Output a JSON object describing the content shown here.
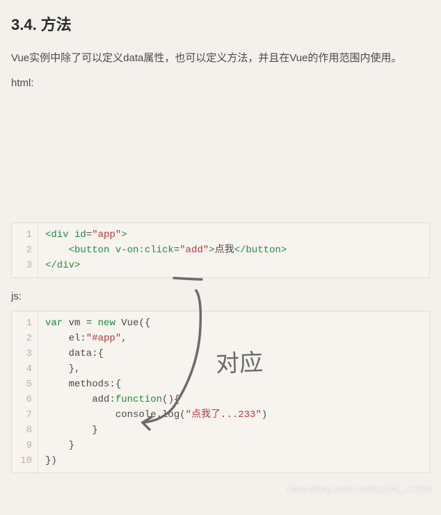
{
  "heading": "3.4. 方法",
  "paragraph": "Vue实例中除了可以定义data属性，也可以定义方法，并且在Vue的作用范围内使用。",
  "label_html": "html:",
  "label_js": "js:",
  "code_html": {
    "line_numbers": [
      "1",
      "2",
      "3"
    ],
    "l1_open": "<div",
    "l1_attr": " id",
    "l1_eq": "=",
    "l1_val": "\"app\"",
    "l1_close": ">",
    "l2_indent": "    ",
    "l2_open": "<button",
    "l2_attr": " v-on:click",
    "l2_eq": "=",
    "l2_val": "\"add\"",
    "l2_close": ">",
    "l2_text": "点我",
    "l2_end": "</button>",
    "l3": "</div>"
  },
  "code_js": {
    "line_numbers": [
      "1",
      "2",
      "3",
      "4",
      "5",
      "6",
      "7",
      "8",
      "9",
      "10"
    ],
    "l1_var": "var",
    "l1_vm": " vm ",
    "l1_eq": "= ",
    "l1_new": "new",
    "l1_vue": " Vue({",
    "l2": "    el:",
    "l2_val": "\"#app\"",
    "l2_comma": ",",
    "l3": "    data:{",
    "l4": "    },",
    "l5": "    methods:{",
    "l6": "        add:",
    "l6_fn": "function",
    "l6_paren": "(){",
    "l7": "            console.log(",
    "l7_str": "\"点我了...233\"",
    "l7_close": ")",
    "l8": "        }",
    "l9": "    }",
    "l10": "})"
  },
  "annotation_text": "对应",
  "watermark": "https://blog.csdn.net/GLOAL_COOK"
}
